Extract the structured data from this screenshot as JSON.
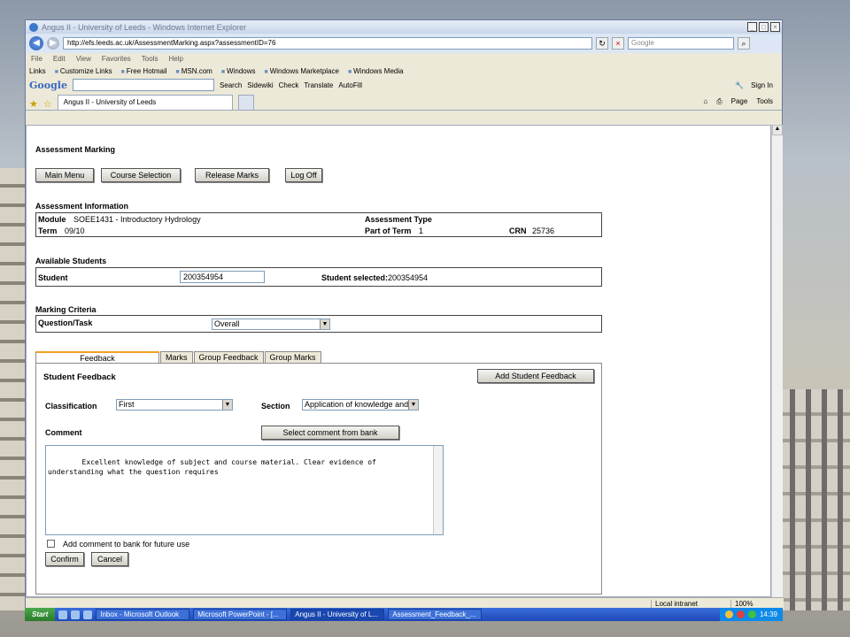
{
  "browser": {
    "title": "Angus II - University of Leeds - Windows Internet Explorer",
    "url": "http://efs.leeds.ac.uk/AssessmentMarking.aspx?assessmentID=76",
    "search_placeholder": "Google",
    "menu": [
      "File",
      "Edit",
      "View",
      "Favorites",
      "Tools",
      "Help"
    ],
    "links_label": "Links",
    "links": [
      "Customize Links",
      "Free Hotmail",
      "MSN.com",
      "Windows",
      "Windows Marketplace",
      "Windows Media"
    ],
    "google_toolbar": {
      "logo": "Google",
      "items": [
        "Search",
        "Sidewiki",
        "Check",
        "Translate",
        "AutoFill"
      ],
      "sign_in": "Sign In"
    },
    "tab_title": "Angus II - University of Leeds",
    "commands": [
      "Page",
      "Tools"
    ],
    "status_zone": "Local intranet",
    "zoom": "100%"
  },
  "page": {
    "title": "Assessment Marking",
    "nav_buttons": [
      "Main Menu",
      "Course Selection",
      "Release Marks",
      "Log Off"
    ],
    "assessment_info": {
      "heading": "Assessment Information",
      "module_label": "Module",
      "module_value": "SOEE1431 - Introductory Hydrology",
      "assessment_type_label": "Assessment Type",
      "term_label": "Term",
      "term_value": "09/10",
      "part_of_term_label": "Part of Term",
      "part_of_term_value": "1",
      "crn_label": "CRN",
      "crn_value": "25736"
    },
    "students": {
      "heading": "Available Students",
      "student_label": "Student",
      "student_value": "200354954",
      "selected_label": "Student selected:",
      "selected_value": "200354954"
    },
    "criteria": {
      "heading": "Marking Criteria",
      "question_label": "Question/Task",
      "question_value": "Overall"
    },
    "tabs": [
      "Feedback",
      "Marks",
      "Group Feedback",
      "Group Marks"
    ],
    "feedback": {
      "heading": "Student Feedback",
      "add_button": "Add Student Feedback",
      "classification_label": "Classification",
      "classification_value": "First",
      "section_label": "Section",
      "section_value": "Application of knowledge and u",
      "comment_label": "Comment",
      "select_comment_button": "Select comment from bank",
      "comment_text": "Excellent knowledge of subject and course material. Clear evidence of\nunderstanding what the question requires",
      "bank_checkbox_label": "Add comment to bank for future use",
      "confirm_button": "Confirm",
      "cancel_button": "Cancel"
    }
  },
  "taskbar": {
    "start": "Start",
    "tasks": [
      "Inbox - Microsoft Outlook",
      "Microsoft PowerPoint - [...",
      "Angus II - University of L...",
      "Assessment_Feedback_..."
    ],
    "clock": "14:39"
  }
}
